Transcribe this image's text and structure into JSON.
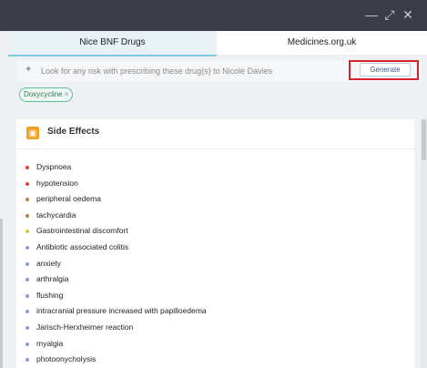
{
  "window": {
    "controls": {
      "minimize": "—",
      "restore": "⤢",
      "close": "✕"
    }
  },
  "tabs": [
    {
      "label": "Nice BNF Drugs",
      "active": true
    },
    {
      "label": "Medicines.org.uk",
      "active": false
    }
  ],
  "search": {
    "placeholder": "Look for any risk with prescribing these drug(s) to Nicole Davies",
    "icon": "sparkle-icon",
    "generate_label": "Generate"
  },
  "chips": [
    {
      "label": "Doxycycline",
      "remove": "×"
    }
  ],
  "panel": {
    "title": "Side Effects",
    "icon": "side-effects-icon",
    "items": [
      {
        "label": "Dyspnoea",
        "color": "#e0453f"
      },
      {
        "label": "hypotension",
        "color": "#e0453f"
      },
      {
        "label": "peripheral oedema",
        "color": "#b5853a"
      },
      {
        "label": "tachycardia",
        "color": "#b5853a"
      },
      {
        "label": "Gastrointestinal discomfort",
        "color": "#d6c93b"
      },
      {
        "label": "Antibiotic associated colitis",
        "color": "#8c9bd6"
      },
      {
        "label": "anxiety",
        "color": "#8c9bd6"
      },
      {
        "label": "arthralgia",
        "color": "#8c9bd6"
      },
      {
        "label": "flushing",
        "color": "#8c9bd6"
      },
      {
        "label": "intracranial pressure increased with papilloedema",
        "color": "#8c9bd6"
      },
      {
        "label": "Jarisch-Herxheimer reaction",
        "color": "#8c9bd6"
      },
      {
        "label": "myalgia",
        "color": "#8c9bd6"
      },
      {
        "label": "photoonycholysis",
        "color": "#8c9bd6"
      }
    ]
  }
}
